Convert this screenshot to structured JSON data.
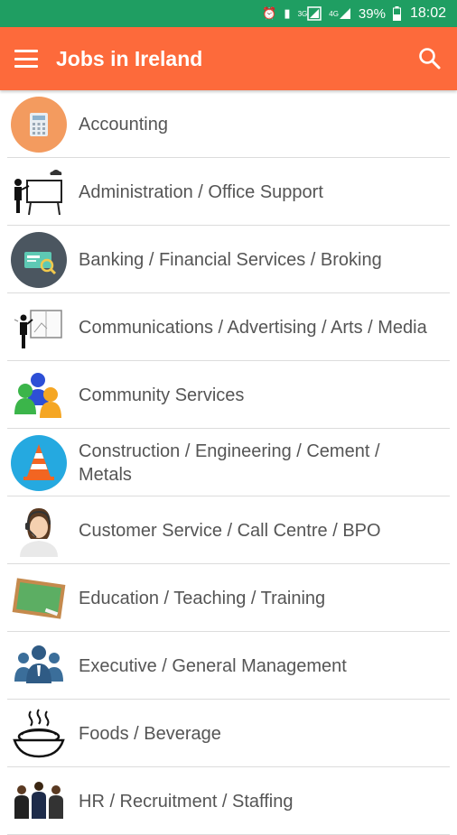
{
  "status_bar": {
    "network_label_1": "3G",
    "network_label_2": "4G",
    "battery": "39%",
    "time": "18:02"
  },
  "app_bar": {
    "title": "Jobs in Ireland",
    "color": "#fd6a3b"
  },
  "categories": [
    {
      "label": "Accounting",
      "icon": "calculator-icon"
    },
    {
      "label": "Administration / Office Support",
      "icon": "presentation-board-icon"
    },
    {
      "label": "Banking / Financial Services / Broking",
      "icon": "credit-card-icon"
    },
    {
      "label": "Communications / Advertising / Arts / Media",
      "icon": "billboard-icon"
    },
    {
      "label": "Community Services",
      "icon": "people-group-icon"
    },
    {
      "label": "Construction / Engineering / Cement / Metals",
      "icon": "traffic-cone-icon"
    },
    {
      "label": "Customer Service / Call Centre / BPO",
      "icon": "call-centre-agent-icon"
    },
    {
      "label": "Education / Teaching / Training",
      "icon": "chalkboard-icon"
    },
    {
      "label": "Executive / General Management",
      "icon": "executives-icon"
    },
    {
      "label": "Foods / Beverage",
      "icon": "food-bowl-icon"
    },
    {
      "label": "HR / Recruitment / Staffing",
      "icon": "staff-people-icon"
    }
  ]
}
